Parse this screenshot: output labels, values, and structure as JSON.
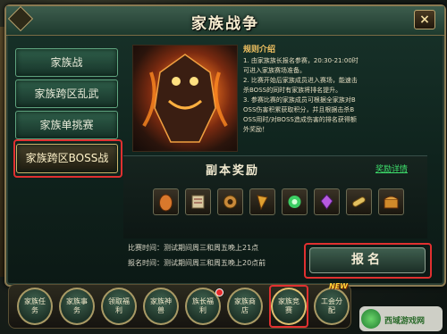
{
  "window": {
    "title": "家族战争",
    "close_label": "×"
  },
  "nav": {
    "items": [
      {
        "label": "家族战"
      },
      {
        "label": "家族跨区乱武"
      },
      {
        "label": "家族单挑赛"
      },
      {
        "label": "家族跨区BOSS战"
      }
    ],
    "active_index": 3
  },
  "rules": {
    "title": "规则介绍",
    "text": "1. 由家族族长报名参赛，20:30-21:00时\n可进入家族赛场准备。\n2. 比赛开始后家族成员进入赛场，能速击\n杀BOSS的同时有家族将排名提升。\n3. 参赛比赛的家族成员可根据全家族对B\nOSS伤害积累获取积分，并且根据击杀B\nOSS用时/对BOSS造成伤害的排名获得额\n外奖励！"
  },
  "rewards": {
    "title": "副本奖励",
    "link_label": "奖励详情",
    "items": [
      {
        "icon": "egg-icon",
        "color": "#d9782c"
      },
      {
        "icon": "scroll-icon",
        "color": "#d9c9a0"
      },
      {
        "icon": "gear-bundle-icon",
        "color": "#c98a3a"
      },
      {
        "icon": "fang-icon",
        "color": "#e0a030"
      },
      {
        "icon": "green-orb-icon",
        "color": "#3ee06c"
      },
      {
        "icon": "purple-crystal-icon",
        "color": "#b65ae0"
      },
      {
        "icon": "golden-scroll-icon",
        "color": "#e2c060"
      },
      {
        "icon": "treasure-chest-icon",
        "color": "#d08a2a"
      }
    ]
  },
  "schedule": {
    "match_time": "比赛时间：测试期间周三和周五晚上21点",
    "signup_time": "报名时间：测试期间周三和周五晚上20点前"
  },
  "signup_button": {
    "label": "报名"
  },
  "bottom": {
    "buttons": [
      {
        "label": "家族任务"
      },
      {
        "label": "家族事务"
      },
      {
        "label": "领取福利"
      },
      {
        "label": "家族神兽"
      },
      {
        "label": "族长福利"
      },
      {
        "label": "家族商店"
      },
      {
        "label": "家族竞赛"
      },
      {
        "label": "工会分配"
      }
    ],
    "new_label": "NEW"
  },
  "watermark": {
    "text": "西域游戏网"
  }
}
